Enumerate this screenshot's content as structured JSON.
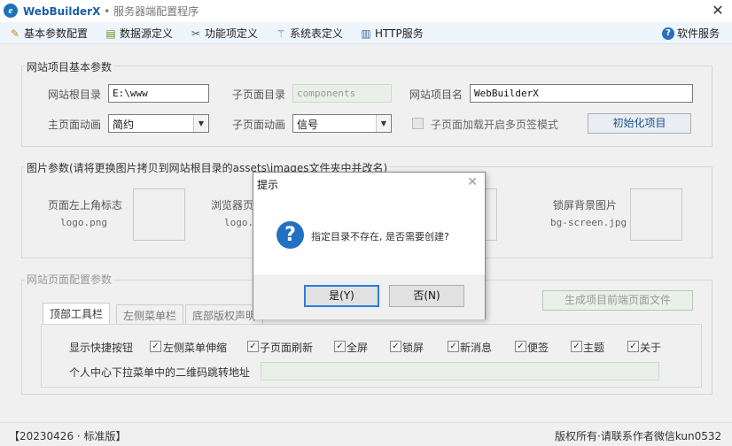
{
  "window": {
    "app_name": "WebBuilderX",
    "separator": " • ",
    "subtitle": "服务器端配置程序",
    "close_glyph": "✕"
  },
  "menu": {
    "items": [
      {
        "label": "基本参数配置",
        "icon": "pencil-icon"
      },
      {
        "label": "数据源定义",
        "icon": "database-icon"
      },
      {
        "label": "功能项定义",
        "icon": "tools-icon"
      },
      {
        "label": "系统表定义",
        "icon": "wand-icon"
      },
      {
        "label": "HTTP服务",
        "icon": "server-icon"
      }
    ],
    "help_label": "软件服务"
  },
  "basic": {
    "title": "网站项目基本参数",
    "root_label": "网站根目录",
    "root_value": "E:\\www",
    "subdir_label": "子页面目录",
    "subdir_value": "components",
    "project_name_label": "网站项目名",
    "project_name_value": "WebBuilderX",
    "main_anim_label": "主页面动画",
    "main_anim_value": "简约",
    "sub_anim_label": "子页面动画",
    "sub_anim_value": "信号",
    "multitab_label": "子页面加载开启多页签模式",
    "init_button": "初始化项目"
  },
  "images": {
    "title": "图片参数(请将更换图片拷贝到网站根目录的assets\\images文件夹中并改名)",
    "top_left_label": "页面左上角标志",
    "top_left_file": "logo.png",
    "browser_label": "浏览器页",
    "browser_file": "logo.",
    "lock_label": "锁屏背景图片",
    "lock_file": "bg-screen.jpg"
  },
  "pagecfg": {
    "title": "网站页面配置参数",
    "tabs": [
      "顶部工具栏",
      "左侧菜单栏",
      "底部版权声明"
    ],
    "generate_button": "生成项目前端页面文件",
    "shortcut_label": "显示快捷按钮",
    "checks": [
      "左侧菜单伸缩",
      "子页面刷新",
      "全屏",
      "锁屏",
      "新消息",
      "便签",
      "主题",
      "关于"
    ],
    "qrcode_label": "个人中心下拉菜单中的二维码跳转地址",
    "qrcode_value": ""
  },
  "status": {
    "left": "【20230426 · 标准版】",
    "right": "版权所有·请联系作者微信kun0532"
  },
  "dialog": {
    "title": "提示",
    "message": "指定目录不存在, 是否需要创建?",
    "yes": "是(Y)",
    "no": "否(N)"
  }
}
